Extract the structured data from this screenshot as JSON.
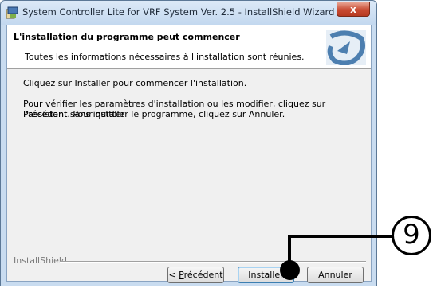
{
  "window": {
    "title": "System Controller Lite for VRF System Ver. 2.5 - InstallShield Wizard",
    "close_label": "x"
  },
  "header": {
    "title": "L'installation du programme peut commencer",
    "subtitle": "Toutes les informations nécessaires à l'installation sont réunies."
  },
  "body": {
    "paragraph1": "Cliquez sur Installer pour commencer l'installation.",
    "paragraph2_line1": "Pour vérifier les paramètres d'installation ou les modifier, cliquez sur Précédent. Pour quitter",
    "paragraph2_line2": "l'assistant sans installer le programme, cliquez sur Annuler."
  },
  "footer": {
    "brand": "InstallShield",
    "back_prefix": "< ",
    "back_underlined": "P",
    "back_rest": "récédent",
    "install_label": "Installer",
    "cancel_label": "Annuler"
  },
  "annotation": {
    "step_number": "9"
  },
  "colors": {
    "close_button": "#c84a32",
    "titlebar": "#c9dcf0",
    "dialog_bg": "#f0f0f0",
    "logo": "#4d7fb0"
  }
}
